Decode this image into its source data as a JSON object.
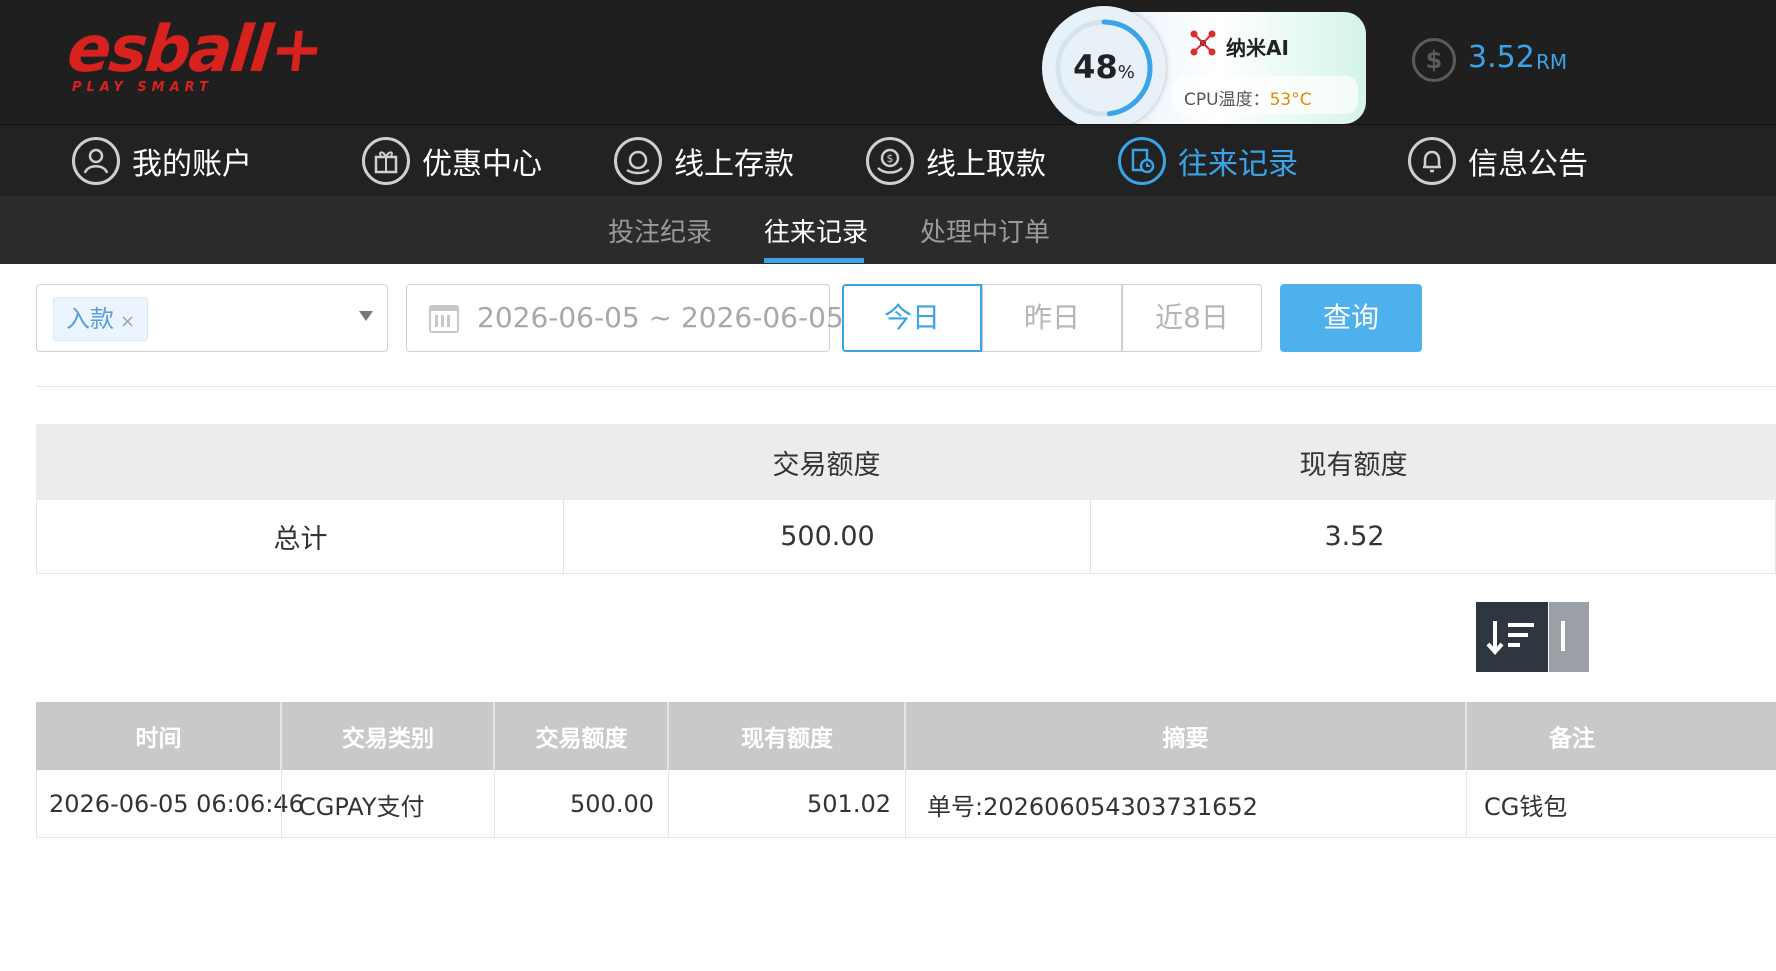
{
  "brand": {
    "logo_main": "esball+",
    "logo_sub": "PLAY SMART"
  },
  "ai_widget": {
    "percent": "48",
    "percent_sign": "%",
    "percent_value": 0.48,
    "title": "纳米AI",
    "temp_label": "CPU温度：",
    "temp_value": "53°C",
    "temp_color": "#e58a00"
  },
  "balance": {
    "value": "3.52",
    "unit": "RM"
  },
  "nav": {
    "items": [
      {
        "label": "我的账户",
        "icon": "user-icon"
      },
      {
        "label": "优惠中心",
        "icon": "gift-icon"
      },
      {
        "label": "线上存款",
        "icon": "deposit-icon"
      },
      {
        "label": "线上取款",
        "icon": "withdraw-icon"
      },
      {
        "label": "往来记录",
        "icon": "records-icon"
      },
      {
        "label": "信息公告",
        "icon": "bell-icon"
      }
    ],
    "active_color": "#3ba3e8"
  },
  "subnav": {
    "items": [
      "投注纪录",
      "往来记录",
      "处理中订单"
    ]
  },
  "filters": {
    "type_tag": "入款",
    "tag_close": "×",
    "date_range": "2026-06-05 ~ 2026-06-05",
    "quick": [
      "今日",
      "昨日",
      "近8日"
    ],
    "query_label": "查询"
  },
  "summary": {
    "headers": [
      "",
      "交易额度",
      "现有额度"
    ],
    "row": [
      "总计",
      "500.00",
      "3.52"
    ]
  },
  "records": {
    "headers": [
      "时间",
      "交易类别",
      "交易额度",
      "现有额度",
      "摘要",
      "备注"
    ],
    "rows": [
      [
        "2026-06-05 06:06:46",
        "CGPAY支付",
        "500.00",
        "501.02",
        "单号:202606054303731652",
        "CG钱包"
      ]
    ]
  }
}
